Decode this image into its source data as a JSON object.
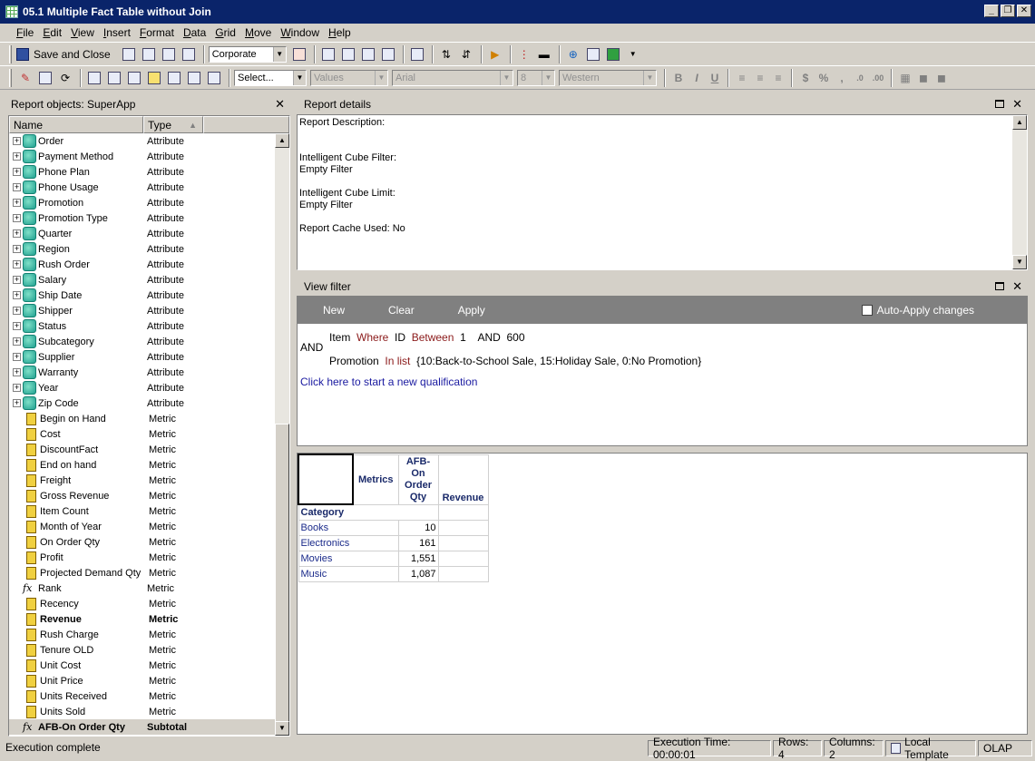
{
  "window": {
    "title": "05.1 Multiple Fact Table without Join"
  },
  "menu": [
    "File",
    "Edit",
    "View",
    "Insert",
    "Format",
    "Data",
    "Grid",
    "Move",
    "Window",
    "Help"
  ],
  "toolbar": {
    "save_close": "Save and Close",
    "template_value": "Corporate",
    "select_placeholder": "Select...",
    "values_combo": "Values",
    "font_combo": "Arial",
    "size_combo": "8",
    "script_combo": "Western",
    "bold": "B",
    "italic": "I",
    "underline": "U",
    "currency": "$",
    "percent": "%",
    "comma": ","
  },
  "left_panel": {
    "title": "Report objects: SuperApp",
    "col_name": "Name",
    "col_type": "Type",
    "items": [
      {
        "name": "Order",
        "type": "Attribute",
        "kind": "attr"
      },
      {
        "name": "Payment Method",
        "type": "Attribute",
        "kind": "attr"
      },
      {
        "name": "Phone Plan",
        "type": "Attribute",
        "kind": "attr"
      },
      {
        "name": "Phone Usage",
        "type": "Attribute",
        "kind": "attr"
      },
      {
        "name": "Promotion",
        "type": "Attribute",
        "kind": "attr"
      },
      {
        "name": "Promotion Type",
        "type": "Attribute",
        "kind": "attr"
      },
      {
        "name": "Quarter",
        "type": "Attribute",
        "kind": "attr"
      },
      {
        "name": "Region",
        "type": "Attribute",
        "kind": "attr"
      },
      {
        "name": "Rush Order",
        "type": "Attribute",
        "kind": "attr"
      },
      {
        "name": "Salary",
        "type": "Attribute",
        "kind": "attr"
      },
      {
        "name": "Ship Date",
        "type": "Attribute",
        "kind": "attr"
      },
      {
        "name": "Shipper",
        "type": "Attribute",
        "kind": "attr"
      },
      {
        "name": "Status",
        "type": "Attribute",
        "kind": "attr"
      },
      {
        "name": "Subcategory",
        "type": "Attribute",
        "kind": "attr"
      },
      {
        "name": "Supplier",
        "type": "Attribute",
        "kind": "attr"
      },
      {
        "name": "Warranty",
        "type": "Attribute",
        "kind": "attr"
      },
      {
        "name": "Year",
        "type": "Attribute",
        "kind": "attr"
      },
      {
        "name": "Zip Code",
        "type": "Attribute",
        "kind": "attr"
      },
      {
        "name": "Begin on Hand",
        "type": "Metric",
        "kind": "metric"
      },
      {
        "name": "Cost",
        "type": "Metric",
        "kind": "metric"
      },
      {
        "name": "DiscountFact",
        "type": "Metric",
        "kind": "metric"
      },
      {
        "name": "End on hand",
        "type": "Metric",
        "kind": "metric"
      },
      {
        "name": "Freight",
        "type": "Metric",
        "kind": "metric"
      },
      {
        "name": "Gross Revenue",
        "type": "Metric",
        "kind": "metric"
      },
      {
        "name": "Item Count",
        "type": "Metric",
        "kind": "metric"
      },
      {
        "name": "Month of Year",
        "type": "Metric",
        "kind": "metric"
      },
      {
        "name": "On Order Qty",
        "type": "Metric",
        "kind": "metric"
      },
      {
        "name": "Profit",
        "type": "Metric",
        "kind": "metric"
      },
      {
        "name": "Projected Demand Qty",
        "type": "Metric",
        "kind": "metric"
      },
      {
        "name": "Rank",
        "type": "Metric",
        "kind": "fx"
      },
      {
        "name": "Recency",
        "type": "Metric",
        "kind": "metric"
      },
      {
        "name": "Revenue",
        "type": "Metric",
        "kind": "metric",
        "bold": true
      },
      {
        "name": "Rush Charge",
        "type": "Metric",
        "kind": "metric"
      },
      {
        "name": "Tenure OLD",
        "type": "Metric",
        "kind": "metric"
      },
      {
        "name": "Unit Cost",
        "type": "Metric",
        "kind": "metric"
      },
      {
        "name": "Unit Price",
        "type": "Metric",
        "kind": "metric"
      },
      {
        "name": "Units Received",
        "type": "Metric",
        "kind": "metric"
      },
      {
        "name": "Units Sold",
        "type": "Metric",
        "kind": "metric"
      },
      {
        "name": "AFB-On Order Qty",
        "type": "Subtotal",
        "kind": "fx",
        "bold": true,
        "selected": true
      }
    ]
  },
  "report_details": {
    "title": "Report details",
    "lines": [
      "Report Description:",
      "",
      "",
      "Intelligent Cube Filter:",
      "Empty Filter",
      "",
      "Intelligent Cube Limit:",
      "Empty Filter",
      "",
      "Report Cache Used: No"
    ]
  },
  "view_filter": {
    "title": "View filter",
    "buttons": {
      "new": "New",
      "clear": "Clear",
      "apply": "Apply"
    },
    "auto_apply": "Auto-Apply changes",
    "and": "AND",
    "cond1": {
      "attr": "Item",
      "where": "Where",
      "field": "ID",
      "op": "Between",
      "v1": "1",
      "and": "AND",
      "v2": "600"
    },
    "cond2": {
      "attr": "Promotion",
      "op": "In list",
      "value": "{10:Back-to-School Sale, 15:Holiday Sale, 0:No Promotion}"
    },
    "new_qual": "Click here to start a new qualification"
  },
  "grid": {
    "metrics_label": "Metrics",
    "row_header": "Category",
    "col1": "AFB-On Order Qty",
    "col2": "Revenue",
    "rows": [
      {
        "category": "Books",
        "qty": "10",
        "revenue": ""
      },
      {
        "category": "Electronics",
        "qty": "161",
        "revenue": ""
      },
      {
        "category": "Movies",
        "qty": "1,551",
        "revenue": ""
      },
      {
        "category": "Music",
        "qty": "1,087",
        "revenue": ""
      }
    ]
  },
  "status": {
    "message": "Execution complete",
    "exec_time": "Execution Time: 00:00:01",
    "rows": "Rows: 4",
    "columns": "Columns: 2",
    "template": "Local Template",
    "mode": "OLAP"
  }
}
